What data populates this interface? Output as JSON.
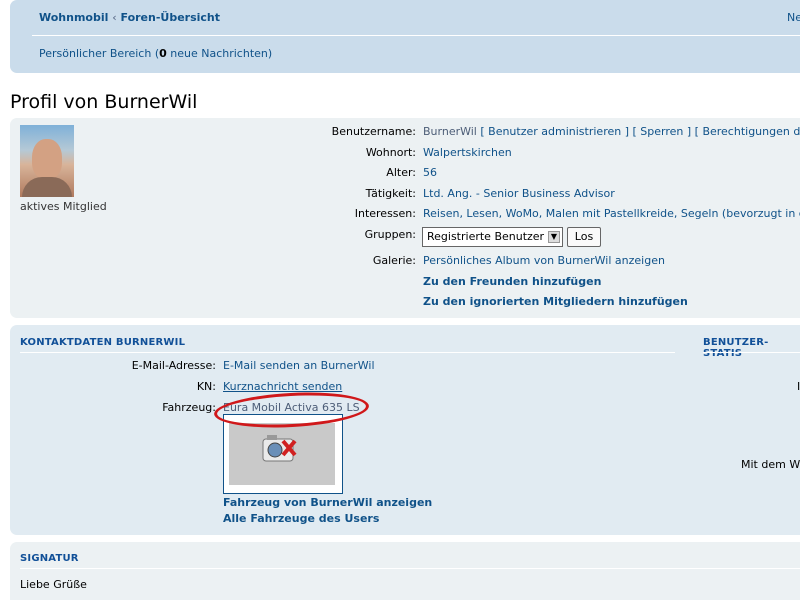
{
  "nav": {
    "home": "Wohnmobil",
    "sep": "‹",
    "forum_index": "Foren-Übersicht",
    "right_link": "Ne",
    "pm_prefix": "Persönlicher Bereich (",
    "pm_count": "0",
    "pm_suffix": " neue Nachrichten)"
  },
  "title": "Profil von BurnerWil",
  "profile": {
    "rank": "aktives Mitglied",
    "username_label": "Benutzername:",
    "username": "BurnerWil",
    "admin_links": "[ Benutzer administrieren ] [ Sperren ] [ Berechtigungen des B",
    "location_label": "Wohnort:",
    "location": "Walpertskirchen",
    "age_label": "Alter:",
    "age": "56",
    "occupation_label": "Tätigkeit:",
    "occupation": "Ltd. Ang. - Senior Business Advisor",
    "interests_label": "Interessen:",
    "interests": "Reisen, Lesen, WoMo, Malen mit Pastellkreide, Segeln (bevorzugt in d",
    "groups_label": "Gruppen:",
    "groups_selected": "Registrierte Benutzer",
    "go_button": "Los",
    "gallery_label": "Galerie:",
    "gallery_link": "Persönliches Album von BurnerWil anzeigen",
    "add_friend": "Zu den Freunden hinzufügen",
    "add_foe": "Zu den ignorierten Mitgliedern hinzufügen"
  },
  "contact": {
    "heading": "KONTAKTDATEN BURNERWIL",
    "stats_heading": "BENUTZER-STATIS",
    "email_label": "E-Mail-Adresse:",
    "email_link": "E-Mail senden an BurnerWil",
    "pm_label": "KN:",
    "pm_link": "Kurznachricht senden",
    "vehicle_label": "Fahrzeug:",
    "vehicle": "Eura Mobil Activa 635 LS",
    "vehicle_show": "Fahrzeug von BurnerWil anzeigen",
    "vehicle_all": "Alle Fahrzeuge des Users",
    "stats_cut_1": "I",
    "stats_cut_2": "Mit dem W"
  },
  "signature": {
    "heading": "SIGNATUR",
    "text": "Liebe Grüße"
  },
  "colors": {
    "link": "#105289",
    "panel": "#ecf1f3",
    "nav": "#cadceb",
    "highlight_oval": "#d0181a"
  }
}
